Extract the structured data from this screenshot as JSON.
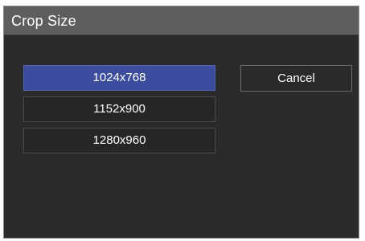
{
  "dialog": {
    "title": "Crop Size",
    "options": [
      {
        "label": "1024x768",
        "selected": true
      },
      {
        "label": "1152x900",
        "selected": false
      },
      {
        "label": "1280x960",
        "selected": false
      }
    ],
    "cancel_label": "Cancel"
  },
  "colors": {
    "dialog_background": "#2b2b2b",
    "titlebar_background": "#5e5e5e",
    "selected_option": "#3c4da0",
    "text": "#ffffff"
  }
}
